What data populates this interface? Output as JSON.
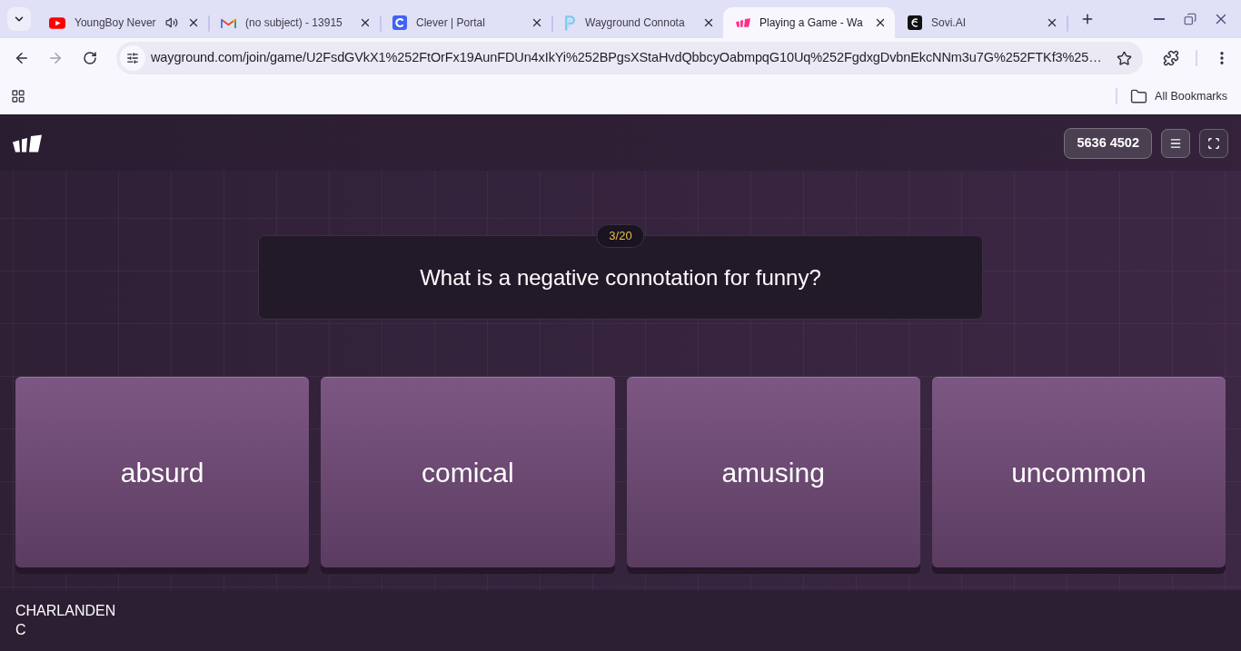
{
  "browser": {
    "tabs": [
      {
        "title": "YoungBoy Never",
        "selected": false,
        "audio": true
      },
      {
        "title": "(no subject) - 13915",
        "selected": false,
        "audio": false
      },
      {
        "title": "Clever | Portal",
        "selected": false,
        "audio": false
      },
      {
        "title": "Wayground Connota",
        "selected": false,
        "audio": false
      },
      {
        "title": "Playing a Game - Wa",
        "selected": true,
        "audio": false
      },
      {
        "title": "Sovi.AI",
        "selected": false,
        "audio": false
      }
    ],
    "address": "wayground.com/join/game/U2FsdGVkX1%252FtOrFx19AunFDUn4xIkYi%252BPgsXStaHvdQbbcyOabmpqG10Uq%252FgdxgDvbnEkcNNm3u7G%252FTKf3%25…",
    "bookmarks": [
      {
        "label": "All Bookmarks"
      }
    ]
  },
  "game": {
    "room_code": "5636 4502",
    "question": {
      "counter": "3/20",
      "text": "What is a negative connotation for funny?"
    },
    "options": [
      {
        "label": "absurd"
      },
      {
        "label": "comical"
      },
      {
        "label": "amusing"
      },
      {
        "label": "uncommon"
      }
    ],
    "player": "CHARLANDEN C"
  }
}
